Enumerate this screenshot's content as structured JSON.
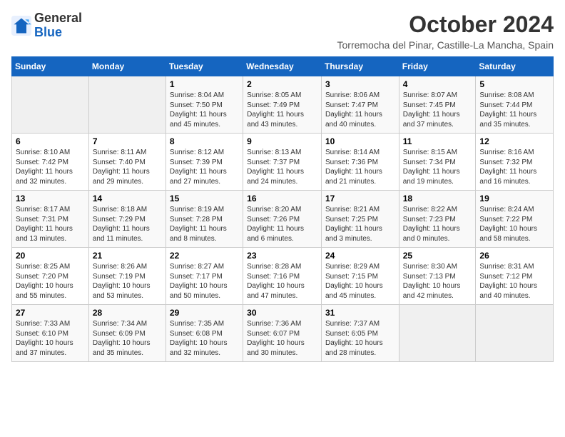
{
  "header": {
    "logo_line1": "General",
    "logo_line2": "Blue",
    "month": "October 2024",
    "location": "Torremocha del Pinar, Castille-La Mancha, Spain"
  },
  "weekdays": [
    "Sunday",
    "Monday",
    "Tuesday",
    "Wednesday",
    "Thursday",
    "Friday",
    "Saturday"
  ],
  "weeks": [
    [
      {
        "day": "",
        "info": ""
      },
      {
        "day": "",
        "info": ""
      },
      {
        "day": "1",
        "info": "Sunrise: 8:04 AM\nSunset: 7:50 PM\nDaylight: 11 hours and 45 minutes."
      },
      {
        "day": "2",
        "info": "Sunrise: 8:05 AM\nSunset: 7:49 PM\nDaylight: 11 hours and 43 minutes."
      },
      {
        "day": "3",
        "info": "Sunrise: 8:06 AM\nSunset: 7:47 PM\nDaylight: 11 hours and 40 minutes."
      },
      {
        "day": "4",
        "info": "Sunrise: 8:07 AM\nSunset: 7:45 PM\nDaylight: 11 hours and 37 minutes."
      },
      {
        "day": "5",
        "info": "Sunrise: 8:08 AM\nSunset: 7:44 PM\nDaylight: 11 hours and 35 minutes."
      }
    ],
    [
      {
        "day": "6",
        "info": "Sunrise: 8:10 AM\nSunset: 7:42 PM\nDaylight: 11 hours and 32 minutes."
      },
      {
        "day": "7",
        "info": "Sunrise: 8:11 AM\nSunset: 7:40 PM\nDaylight: 11 hours and 29 minutes."
      },
      {
        "day": "8",
        "info": "Sunrise: 8:12 AM\nSunset: 7:39 PM\nDaylight: 11 hours and 27 minutes."
      },
      {
        "day": "9",
        "info": "Sunrise: 8:13 AM\nSunset: 7:37 PM\nDaylight: 11 hours and 24 minutes."
      },
      {
        "day": "10",
        "info": "Sunrise: 8:14 AM\nSunset: 7:36 PM\nDaylight: 11 hours and 21 minutes."
      },
      {
        "day": "11",
        "info": "Sunrise: 8:15 AM\nSunset: 7:34 PM\nDaylight: 11 hours and 19 minutes."
      },
      {
        "day": "12",
        "info": "Sunrise: 8:16 AM\nSunset: 7:32 PM\nDaylight: 11 hours and 16 minutes."
      }
    ],
    [
      {
        "day": "13",
        "info": "Sunrise: 8:17 AM\nSunset: 7:31 PM\nDaylight: 11 hours and 13 minutes."
      },
      {
        "day": "14",
        "info": "Sunrise: 8:18 AM\nSunset: 7:29 PM\nDaylight: 11 hours and 11 minutes."
      },
      {
        "day": "15",
        "info": "Sunrise: 8:19 AM\nSunset: 7:28 PM\nDaylight: 11 hours and 8 minutes."
      },
      {
        "day": "16",
        "info": "Sunrise: 8:20 AM\nSunset: 7:26 PM\nDaylight: 11 hours and 6 minutes."
      },
      {
        "day": "17",
        "info": "Sunrise: 8:21 AM\nSunset: 7:25 PM\nDaylight: 11 hours and 3 minutes."
      },
      {
        "day": "18",
        "info": "Sunrise: 8:22 AM\nSunset: 7:23 PM\nDaylight: 11 hours and 0 minutes."
      },
      {
        "day": "19",
        "info": "Sunrise: 8:24 AM\nSunset: 7:22 PM\nDaylight: 10 hours and 58 minutes."
      }
    ],
    [
      {
        "day": "20",
        "info": "Sunrise: 8:25 AM\nSunset: 7:20 PM\nDaylight: 10 hours and 55 minutes."
      },
      {
        "day": "21",
        "info": "Sunrise: 8:26 AM\nSunset: 7:19 PM\nDaylight: 10 hours and 53 minutes."
      },
      {
        "day": "22",
        "info": "Sunrise: 8:27 AM\nSunset: 7:17 PM\nDaylight: 10 hours and 50 minutes."
      },
      {
        "day": "23",
        "info": "Sunrise: 8:28 AM\nSunset: 7:16 PM\nDaylight: 10 hours and 47 minutes."
      },
      {
        "day": "24",
        "info": "Sunrise: 8:29 AM\nSunset: 7:15 PM\nDaylight: 10 hours and 45 minutes."
      },
      {
        "day": "25",
        "info": "Sunrise: 8:30 AM\nSunset: 7:13 PM\nDaylight: 10 hours and 42 minutes."
      },
      {
        "day": "26",
        "info": "Sunrise: 8:31 AM\nSunset: 7:12 PM\nDaylight: 10 hours and 40 minutes."
      }
    ],
    [
      {
        "day": "27",
        "info": "Sunrise: 7:33 AM\nSunset: 6:10 PM\nDaylight: 10 hours and 37 minutes."
      },
      {
        "day": "28",
        "info": "Sunrise: 7:34 AM\nSunset: 6:09 PM\nDaylight: 10 hours and 35 minutes."
      },
      {
        "day": "29",
        "info": "Sunrise: 7:35 AM\nSunset: 6:08 PM\nDaylight: 10 hours and 32 minutes."
      },
      {
        "day": "30",
        "info": "Sunrise: 7:36 AM\nSunset: 6:07 PM\nDaylight: 10 hours and 30 minutes."
      },
      {
        "day": "31",
        "info": "Sunrise: 7:37 AM\nSunset: 6:05 PM\nDaylight: 10 hours and 28 minutes."
      },
      {
        "day": "",
        "info": ""
      },
      {
        "day": "",
        "info": ""
      }
    ]
  ]
}
